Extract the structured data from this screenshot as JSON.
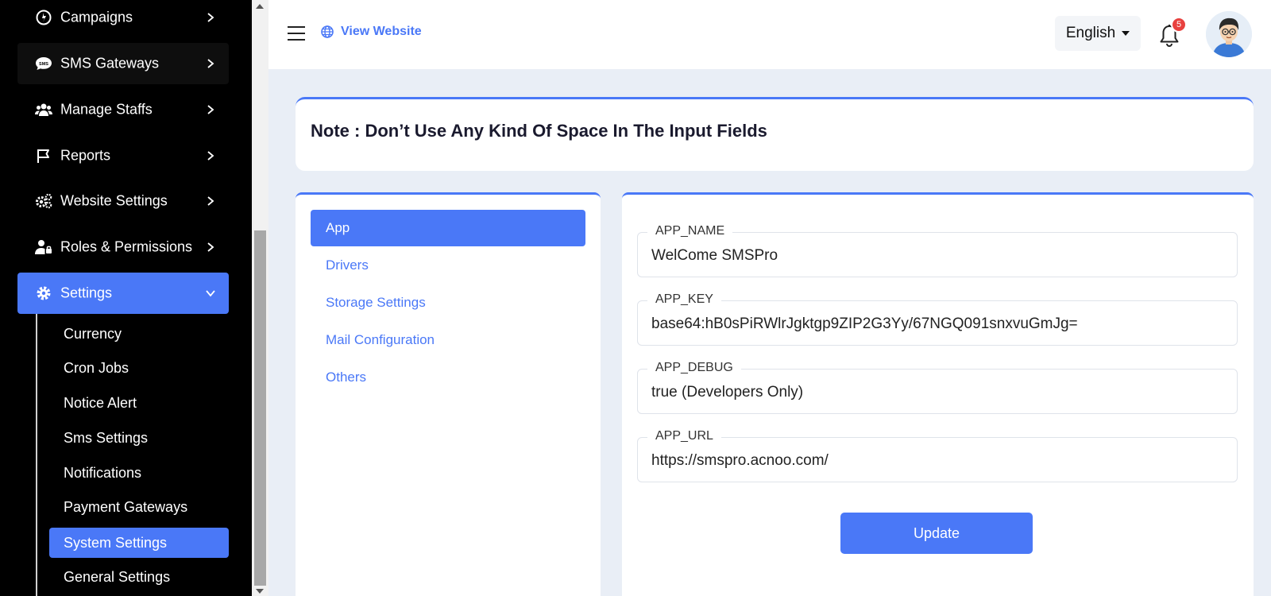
{
  "sidebar": {
    "items": [
      {
        "label": "Campaigns",
        "icon": "campaign-icon"
      },
      {
        "label": "SMS Gateways",
        "icon": "sms-icon"
      },
      {
        "label": "Manage Staffs",
        "icon": "users-icon"
      },
      {
        "label": "Reports",
        "icon": "flag-icon"
      },
      {
        "label": "Website Settings",
        "icon": "gears-icon"
      },
      {
        "label": "Roles & Permissions",
        "icon": "user-lock-icon"
      },
      {
        "label": "Settings",
        "icon": "gear-icon"
      }
    ],
    "sub_items": [
      {
        "label": "Currency"
      },
      {
        "label": "Cron Jobs"
      },
      {
        "label": "Notice Alert"
      },
      {
        "label": "Sms Settings"
      },
      {
        "label": "Notifications"
      },
      {
        "label": "Payment Gateways"
      },
      {
        "label": "System Settings"
      },
      {
        "label": "General Settings"
      }
    ]
  },
  "header": {
    "view_website": "View Website",
    "language": "English",
    "notification_count": "5"
  },
  "note": {
    "text": "Note : Don’t Use Any Kind Of Space In The Input Fields"
  },
  "tabs": [
    {
      "label": "App"
    },
    {
      "label": "Drivers"
    },
    {
      "label": "Storage Settings"
    },
    {
      "label": "Mail Configuration"
    },
    {
      "label": "Others"
    }
  ],
  "form": {
    "fields": [
      {
        "label": "APP_NAME",
        "value": "WelCome SMSPro"
      },
      {
        "label": "APP_KEY",
        "value": "base64:hB0sPiRWlrJgktgp9ZIP2G3Yy/67NGQ091snxvuGmJg="
      },
      {
        "label": "APP_DEBUG",
        "value": "true (Developers Only)"
      },
      {
        "label": "APP_URL",
        "value": "https://smspro.acnoo.com/"
      }
    ],
    "update_label": "Update"
  },
  "colors": {
    "accent": "#4a78f7",
    "sidebar_bg": "#000000",
    "page_bg": "#e9eef6",
    "badge": "#e8413f"
  }
}
